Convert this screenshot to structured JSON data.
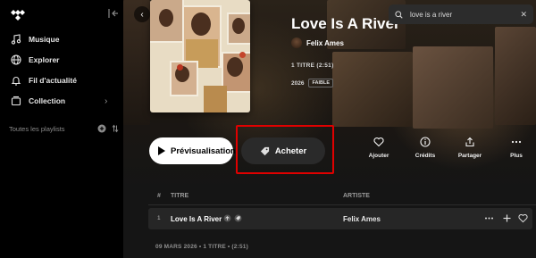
{
  "sidebar": {
    "items": [
      {
        "label": "Musique",
        "icon": "music-note-icon"
      },
      {
        "label": "Explorer",
        "icon": "globe-icon"
      },
      {
        "label": "Fil d'actualité",
        "icon": "bell-icon"
      },
      {
        "label": "Collection",
        "icon": "collection-icon"
      }
    ],
    "playlists_label": "Toutes les playlists"
  },
  "search": {
    "value": "love is a river"
  },
  "album": {
    "title": "Love Is A River",
    "artist": "Felix Ames",
    "meta_tracks": "1 TITRE (2:51)",
    "year": "2026",
    "quality_badge": "FAIBLE"
  },
  "buttons": {
    "preview": "Prévisualisation",
    "buy": "Acheter"
  },
  "actions": [
    {
      "label": "Ajouter",
      "icon": "heart-icon"
    },
    {
      "label": "Crédits",
      "icon": "info-icon"
    },
    {
      "label": "Partager",
      "icon": "share-icon"
    },
    {
      "label": "Plus",
      "icon": "more-icon"
    }
  ],
  "table": {
    "headers": {
      "num": "#",
      "title": "TITRE",
      "artist": "ARTISTE"
    },
    "rows": [
      {
        "num": "1",
        "title": "Love Is A River",
        "artist": "Felix Ames"
      }
    ]
  },
  "footer": "09 MARS 2026  •  1 TITRE  •  (2:51)",
  "colors": {
    "highlight": "#e00000",
    "background": "#000000",
    "panel": "#151515"
  }
}
